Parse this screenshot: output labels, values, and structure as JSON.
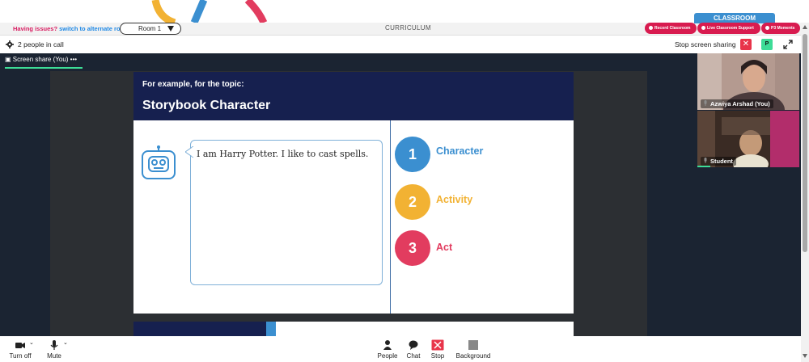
{
  "topbar": {
    "issues_prefix": "Having issues?",
    "issues_link": "switch to alternate room",
    "room_label": "Room 1",
    "curriculum_label": "CURRICULUM",
    "classroom_tab": "CLASSROOM",
    "pills": [
      "Record Classroom",
      "Live Classroom Support",
      "P3 Moments"
    ]
  },
  "call": {
    "people_count": "2 people in call",
    "stop_share_label": "Stop screen sharing",
    "profile_initial": "P",
    "screen_tab_label": "Screen share (You)",
    "screen_tab_more": "•••"
  },
  "slide": {
    "subtitle": "For example, for the topic:",
    "title": "Storybook Character",
    "bubble_text": "I am Harry Potter. I like to cast spells.",
    "steps": [
      {
        "num": "1",
        "label": "Character",
        "color": "#3b8fd0"
      },
      {
        "num": "2",
        "label": "Activity",
        "color": "#f2b233"
      },
      {
        "num": "3",
        "label": "Act",
        "color": "#e23c5f"
      }
    ]
  },
  "participants": [
    {
      "name": "Azwiya Arshad (You)"
    },
    {
      "name": "Student"
    }
  ],
  "toolbar": {
    "turn_off": "Turn off",
    "mute": "Mute",
    "people": "People",
    "chat": "Chat",
    "stop": "Stop",
    "background": "Background"
  },
  "colors": {
    "brand_red": "#d81b4f",
    "brand_blue": "#3b8fd0",
    "accent_green": "#3ddc97",
    "slide_navy": "#16204f"
  }
}
